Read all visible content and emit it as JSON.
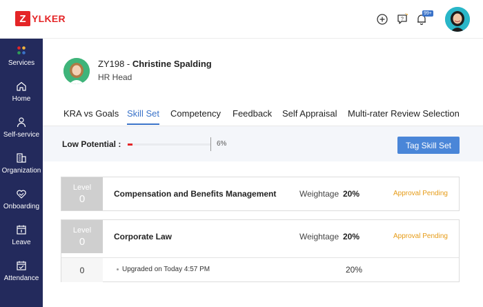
{
  "brand": {
    "logo_letter": "Z",
    "logo_text": "YLKER",
    "color": "#e42527"
  },
  "header": {
    "notification_count": "99+",
    "icons": [
      "add-circle-icon",
      "help-icon",
      "bell-icon"
    ]
  },
  "sidebar": {
    "items": [
      {
        "label": "Services",
        "icon": "services-icon"
      },
      {
        "label": "Home",
        "icon": "home-icon"
      },
      {
        "label": "Self-service",
        "icon": "person-icon"
      },
      {
        "label": "Organization",
        "icon": "organization-icon"
      },
      {
        "label": "Onboarding",
        "icon": "onboarding-icon"
      },
      {
        "label": "Leave",
        "icon": "calendar-icon"
      },
      {
        "label": "Attendance",
        "icon": "attendance-icon"
      }
    ]
  },
  "profile": {
    "emp_id": "ZY198",
    "separator": " - ",
    "name": "Christine Spalding",
    "role": "HR Head"
  },
  "tabs": [
    {
      "label": "KRA vs Goals"
    },
    {
      "label": "Skill Set"
    },
    {
      "label": "Competency"
    },
    {
      "label": "Feedback"
    },
    {
      "label": "Self Appraisal"
    },
    {
      "label": "Multi-rater Review Selection"
    }
  ],
  "active_tab": "Skill Set",
  "potential": {
    "label": "Low Potential :",
    "percent": "6%",
    "value": 0.06
  },
  "tag_button": "Tag Skill Set",
  "skills": [
    {
      "level_label": "Level",
      "level": "0",
      "name": "Compensation and Benefits Management",
      "weightage_label": "Weightage",
      "weightage": "20%",
      "status": "Approval Pending"
    },
    {
      "level_label": "Level",
      "level": "0",
      "name": "Corporate Law",
      "weightage_label": "Weightage",
      "weightage": "20%",
      "status": "Approval Pending",
      "history": {
        "level": "0",
        "text": "Upgraded on Today 4:57 PM",
        "weightage": "20%"
      }
    }
  ],
  "colors": {
    "accent": "#3a73c9",
    "sidebar_bg": "#232a5c",
    "status_pending": "#e69b16",
    "button_bg": "#4a86d8"
  }
}
